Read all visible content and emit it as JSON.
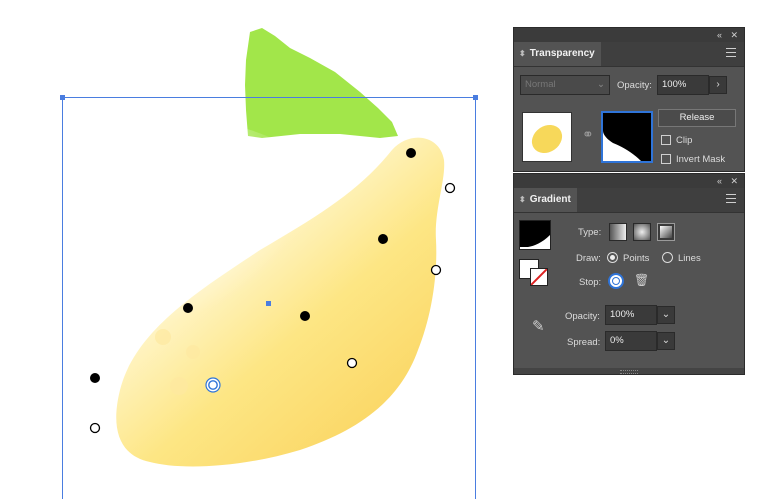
{
  "transparency": {
    "tab_label": "Transparency",
    "blend_mode": "Normal",
    "opacity_label": "Opacity:",
    "opacity_value": "100%",
    "release_label": "Release",
    "clip_label": "Clip",
    "invert_mask_label": "Invert Mask"
  },
  "gradient": {
    "tab_label": "Gradient",
    "type_label": "Type:",
    "draw_label": "Draw:",
    "draw_points": "Points",
    "draw_lines": "Lines",
    "stop_label": "Stop:",
    "opacity_label": "Opacity:",
    "opacity_value": "100%",
    "spread_label": "Spread:",
    "spread_value": "0%"
  },
  "panel_controls": {
    "collapse": "«",
    "close": "✕"
  },
  "colors": {
    "panel_bg": "#535353",
    "lemon_yellow": "#fde27a",
    "leaf_green": "#a2e64a",
    "selection_blue": "#4a7de0",
    "accent_blue": "#2f74d8"
  }
}
